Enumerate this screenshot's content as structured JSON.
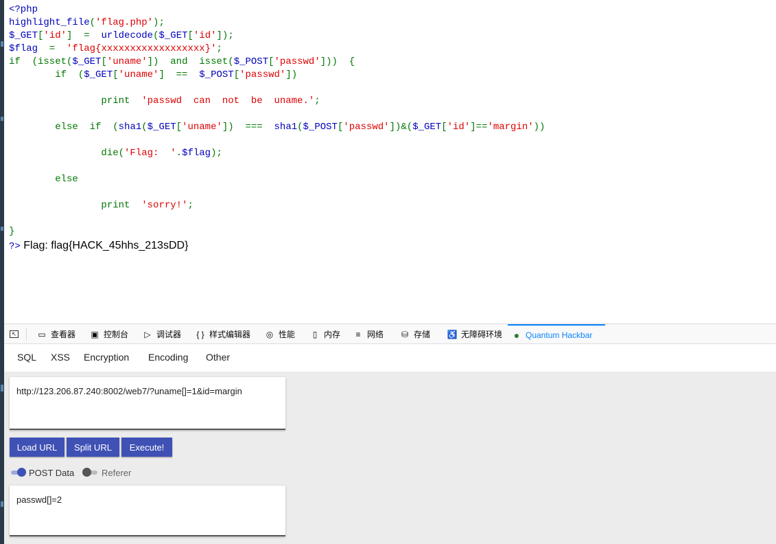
{
  "source": {
    "lines": [
      [
        {
          "t": "<?php",
          "c": "v"
        }
      ],
      [
        {
          "t": "highlight_file",
          "c": "v"
        },
        {
          "t": "(",
          "c": "k"
        },
        {
          "t": "'flag.php'",
          "c": "s"
        },
        {
          "t": ");",
          "c": "k"
        }
      ],
      [
        {
          "t": "$_GET",
          "c": "v"
        },
        {
          "t": "[",
          "c": "k"
        },
        {
          "t": "'id'",
          "c": "s"
        },
        {
          "t": "]  =  ",
          "c": "k"
        },
        {
          "t": "urldecode",
          "c": "v"
        },
        {
          "t": "(",
          "c": "k"
        },
        {
          "t": "$_GET",
          "c": "v"
        },
        {
          "t": "[",
          "c": "k"
        },
        {
          "t": "'id'",
          "c": "s"
        },
        {
          "t": "]);",
          "c": "k"
        }
      ],
      [
        {
          "t": "$flag  ",
          "c": "v"
        },
        {
          "t": "=  ",
          "c": "k"
        },
        {
          "t": "'flag{xxxxxxxxxxxxxxxxxx}'",
          "c": "s"
        },
        {
          "t": ";",
          "c": "k"
        }
      ],
      [
        {
          "t": "if  (isset(",
          "c": "k"
        },
        {
          "t": "$_GET",
          "c": "v"
        },
        {
          "t": "[",
          "c": "k"
        },
        {
          "t": "'uname'",
          "c": "s"
        },
        {
          "t": "])  and  isset(",
          "c": "k"
        },
        {
          "t": "$_POST",
          "c": "v"
        },
        {
          "t": "[",
          "c": "k"
        },
        {
          "t": "'passwd'",
          "c": "s"
        },
        {
          "t": "]))  {",
          "c": "k"
        }
      ],
      [
        {
          "t": "        if  (",
          "c": "k"
        },
        {
          "t": "$_GET",
          "c": "v"
        },
        {
          "t": "[",
          "c": "k"
        },
        {
          "t": "'uname'",
          "c": "s"
        },
        {
          "t": "]  ==  ",
          "c": "k"
        },
        {
          "t": "$_POST",
          "c": "v"
        },
        {
          "t": "[",
          "c": "k"
        },
        {
          "t": "'passwd'",
          "c": "s"
        },
        {
          "t": "])",
          "c": "k"
        }
      ],
      [],
      [
        {
          "t": "                print  ",
          "c": "k"
        },
        {
          "t": "'passwd  can  not  be  uname.'",
          "c": "s"
        },
        {
          "t": ";",
          "c": "k"
        }
      ],
      [],
      [
        {
          "t": "        else  if  (",
          "c": "k"
        },
        {
          "t": "sha1",
          "c": "v"
        },
        {
          "t": "(",
          "c": "k"
        },
        {
          "t": "$_GET",
          "c": "v"
        },
        {
          "t": "[",
          "c": "k"
        },
        {
          "t": "'uname'",
          "c": "s"
        },
        {
          "t": "])  ===  ",
          "c": "k"
        },
        {
          "t": "sha1",
          "c": "v"
        },
        {
          "t": "(",
          "c": "k"
        },
        {
          "t": "$_POST",
          "c": "v"
        },
        {
          "t": "[",
          "c": "k"
        },
        {
          "t": "'passwd'",
          "c": "s"
        },
        {
          "t": "])&(",
          "c": "k"
        },
        {
          "t": "$_GET",
          "c": "v"
        },
        {
          "t": "[",
          "c": "k"
        },
        {
          "t": "'id'",
          "c": "s"
        },
        {
          "t": "]==",
          "c": "k"
        },
        {
          "t": "'margin'",
          "c": "s"
        },
        {
          "t": "))",
          "c": "k"
        }
      ],
      [],
      [
        {
          "t": "                die(",
          "c": "k"
        },
        {
          "t": "'Flag:  '",
          "c": "s"
        },
        {
          "t": ".",
          "c": "k"
        },
        {
          "t": "$flag",
          "c": "v"
        },
        {
          "t": ");",
          "c": "k"
        }
      ],
      [],
      [
        {
          "t": "        else",
          "c": "k"
        }
      ],
      [],
      [
        {
          "t": "                print  ",
          "c": "k"
        },
        {
          "t": "'sorry!'",
          "c": "s"
        },
        {
          "t": ";",
          "c": "k"
        }
      ],
      [],
      [
        {
          "t": "}",
          "c": "k"
        }
      ]
    ],
    "php_close": "?>",
    "flag_output": " Flag: flag{HACK_45hhs_213sDD}"
  },
  "devtools": {
    "tabs": [
      {
        "label": "查看器",
        "icon": "inspector-icon",
        "glyph": "▭"
      },
      {
        "label": "控制台",
        "icon": "console-icon",
        "glyph": "▣"
      },
      {
        "label": "调试器",
        "icon": "debugger-icon",
        "glyph": "▷"
      },
      {
        "label": "样式编辑器",
        "icon": "style-editor-icon",
        "glyph": "{ }"
      },
      {
        "label": "性能",
        "icon": "performance-icon",
        "glyph": "◎"
      },
      {
        "label": "内存",
        "icon": "memory-icon",
        "glyph": "▯"
      },
      {
        "label": "网络",
        "icon": "network-icon",
        "glyph": "≡"
      },
      {
        "label": "存储",
        "icon": "storage-icon",
        "glyph": "⛁"
      },
      {
        "label": "无障碍环境",
        "icon": "accessibility-icon",
        "glyph": "♿"
      },
      {
        "label": "Quantum Hackbar",
        "icon": "hackbar-icon",
        "glyph": "●"
      }
    ],
    "active_tab": "Quantum Hackbar"
  },
  "hackbar": {
    "menu": [
      "SQL",
      "XSS",
      "Encryption",
      "Encoding",
      "Other"
    ],
    "url_value": "http://123.206.87.240:8002/web7/?uname[]=1&id=margin",
    "buttons": {
      "load": "Load URL",
      "split": "Split URL",
      "execute": "Execute!"
    },
    "toggles": {
      "post": {
        "label": "POST Data",
        "on": true
      },
      "referer": {
        "label": "Referer",
        "on": false
      }
    },
    "post_value": "passwd[]=2",
    "accent_color": "#3f51b5"
  }
}
